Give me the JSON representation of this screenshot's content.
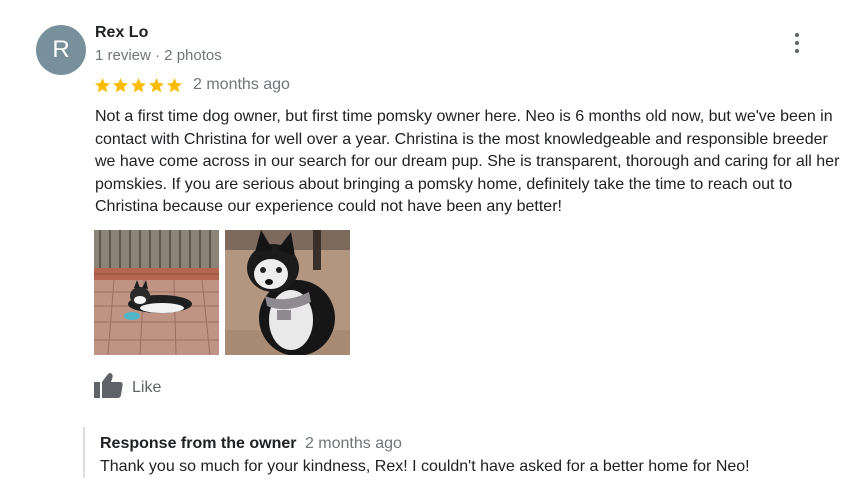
{
  "review": {
    "author": {
      "initial": "R",
      "name": "Rex Lo",
      "meta": "1 review · 2 photos",
      "avatar_color": "#78909c"
    },
    "menu_icon": "more-vert-icon",
    "rating": {
      "stars": 5,
      "max_stars": 5,
      "star_color": "#fbbc04",
      "date": "2 months ago"
    },
    "text": "Not a first time dog owner, but first time pomsky owner here. Neo is 6 months old now, but we've been in contact with Christina for well over a year. Christina is the most knowledgeable and responsible breeder we have come across in our search for our dream pup. She is transparent, thorough and caring for all her pomskies. If you are serious about bringing a pomsky home, definitely take the time to reach out to Christina because our experience could not have been any better!",
    "photos": [
      {
        "name": "photo-puppy-lying-on-bricks"
      },
      {
        "name": "photo-puppy-with-harness"
      }
    ],
    "like": {
      "icon": "thumb-up-icon",
      "label": "Like"
    }
  },
  "owner_response": {
    "title": "Response from the owner",
    "date": "2 months ago",
    "text": "Thank you so much for your kindness, Rex! I couldn't have asked for a better home for Neo!"
  }
}
